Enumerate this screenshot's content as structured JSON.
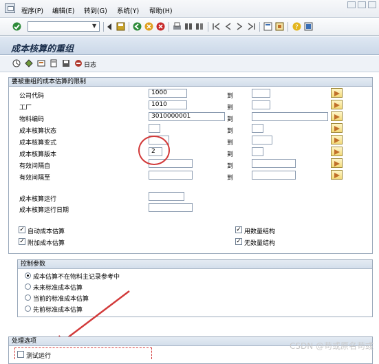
{
  "menu": {
    "items": [
      "程序(P)",
      "编辑(E)",
      "转到(G)",
      "系统(Y)",
      "帮助(H)"
    ]
  },
  "toolbar": {
    "command_value": ""
  },
  "title": "成本核算的重组",
  "app_toolbar": {
    "log_label": "日志"
  },
  "restrictions": {
    "title": "要被重组的成本估算的限制",
    "to_label": "到",
    "rows": [
      {
        "label": "公司代码",
        "from": "1000",
        "to": ""
      },
      {
        "label": "工厂",
        "from": "1010",
        "to": ""
      },
      {
        "label": "物料编码",
        "from": "3010000001",
        "to": ""
      },
      {
        "label": "成本核算状态",
        "from": "",
        "to": ""
      },
      {
        "label": "成本核算变式",
        "from": "",
        "to": ""
      },
      {
        "label": "成本核算版本",
        "from": "2",
        "to": ""
      },
      {
        "label": "有效间隔自",
        "from": "",
        "to": ""
      },
      {
        "label": "有效间隔至",
        "from": "",
        "to": ""
      }
    ],
    "run_label": "成本核算运行",
    "run_value": "",
    "run_date_label": "成本核算运行日期",
    "run_date_value": "",
    "checkboxes_left": [
      {
        "label": "自动成本估算",
        "checked": true
      },
      {
        "label": "附加成本估算",
        "checked": true
      }
    ],
    "checkboxes_right": [
      {
        "label": "用数量结构",
        "checked": true
      },
      {
        "label": "无数量结构",
        "checked": true
      }
    ]
  },
  "control": {
    "title": "控制参数",
    "options": [
      {
        "label": "成本估算不在物料主记录参考中",
        "selected": true
      },
      {
        "label": "未来标准成本估算",
        "selected": false
      },
      {
        "label": "当前的标准成本估算",
        "selected": false
      },
      {
        "label": "先前标准成本估算",
        "selected": false
      }
    ]
  },
  "processing": {
    "title": "处理选项",
    "test_run_label": "测试运行",
    "test_run_checked": false
  },
  "watermark": "CSDN @苟或原名苟彧",
  "colors": {
    "annotation_red": "#d23a3a",
    "title_text": "#1b2f4c"
  }
}
